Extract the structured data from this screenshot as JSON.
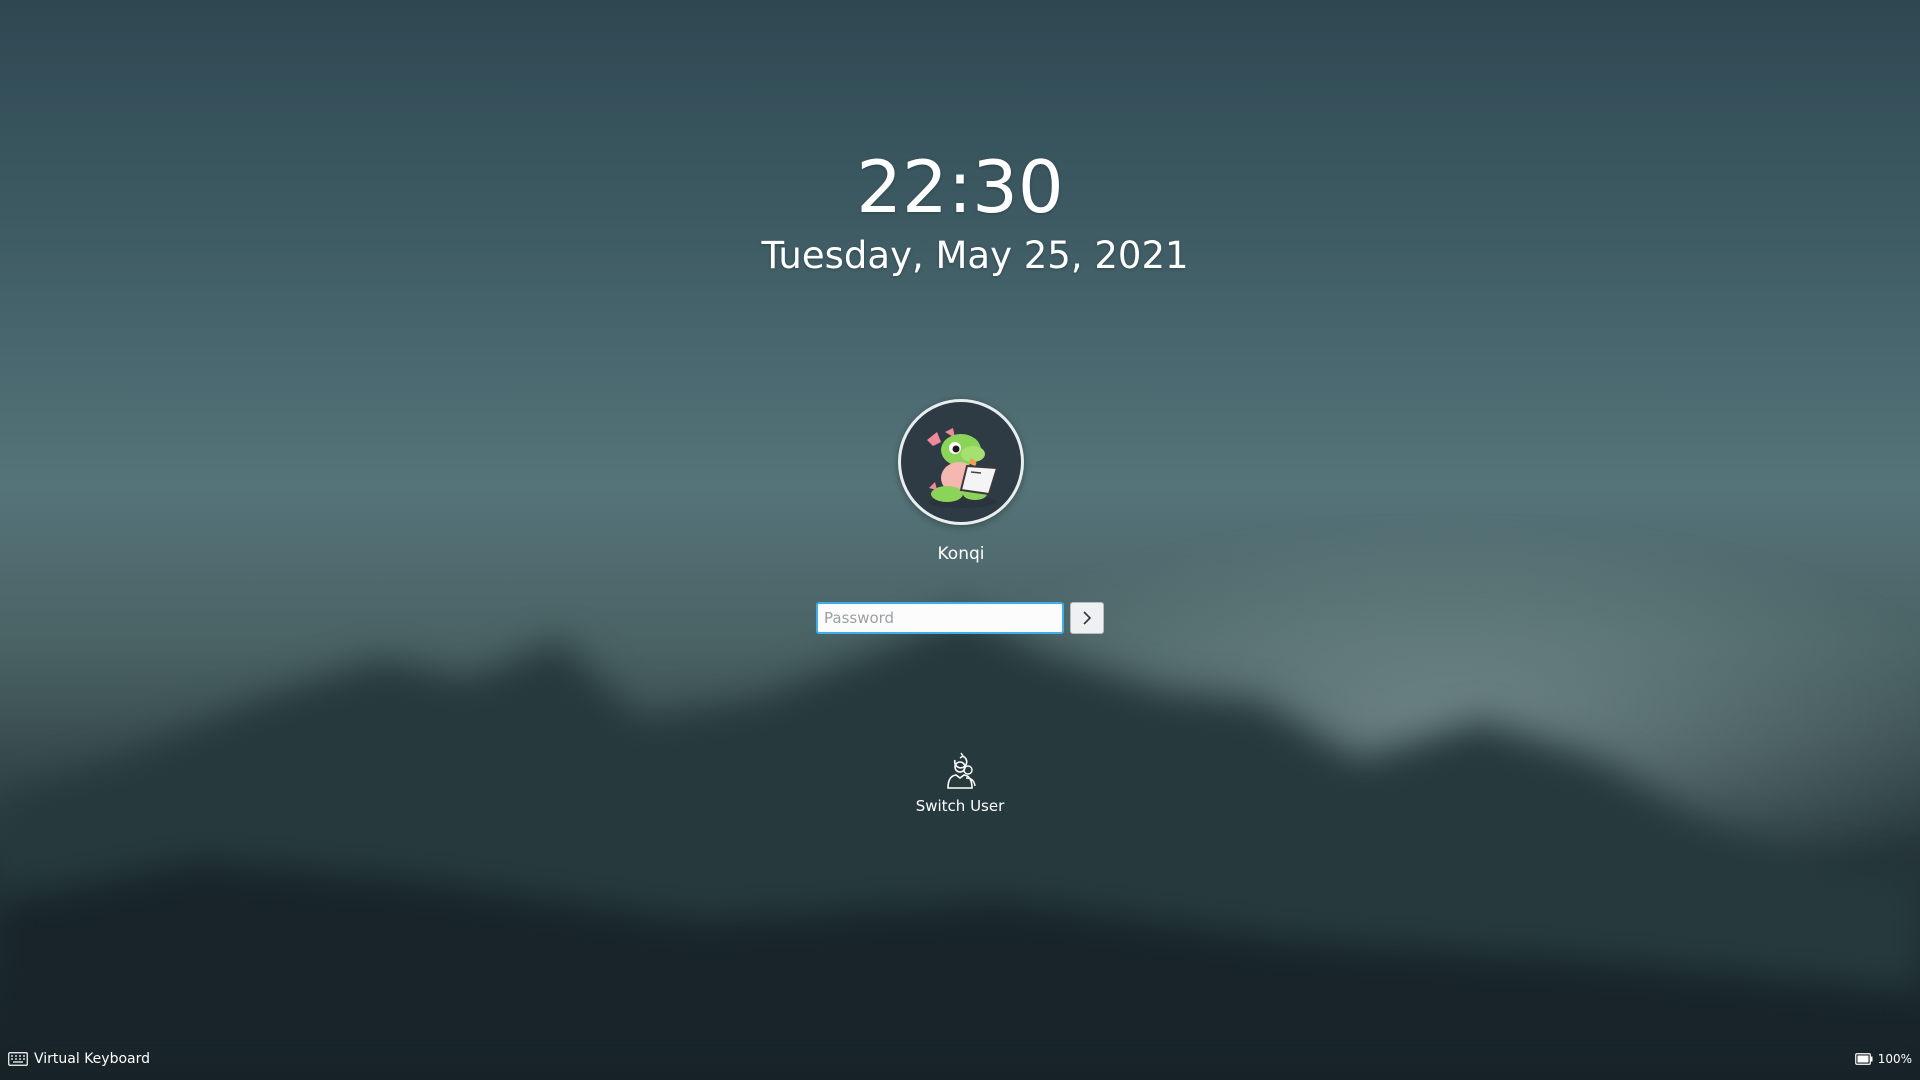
{
  "clock": {
    "time": "22:30",
    "date": "Tuesday, May 25, 2021"
  },
  "user": {
    "name": "Konqi"
  },
  "password": {
    "placeholder": "Password",
    "value": ""
  },
  "actions": {
    "switch_user_label": "Switch User"
  },
  "footer": {
    "virtual_keyboard_label": "Virtual Keyboard",
    "battery_label": "100%"
  },
  "icons": {
    "avatar": "konqi-dragon-avatar",
    "login": "chevron-right-icon",
    "switch_user": "switch-user-icon",
    "keyboard": "keyboard-icon",
    "battery": "battery-icon"
  },
  "colors": {
    "accent": "#3daee9",
    "text": "#ffffff",
    "input_bg": "#fcfcfc"
  },
  "battery_level": 1.0
}
